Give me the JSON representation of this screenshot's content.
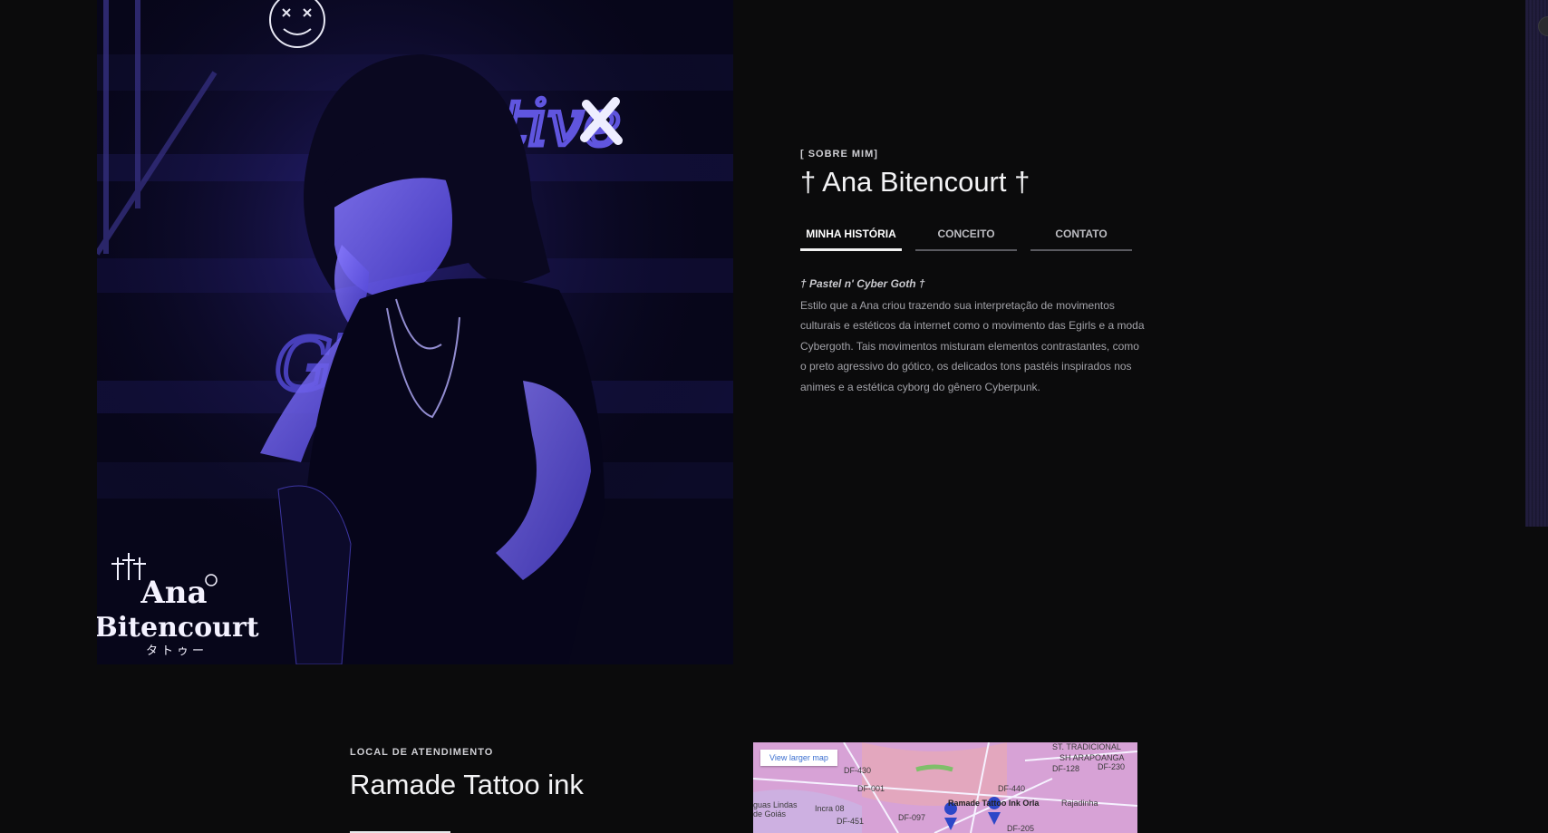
{
  "about": {
    "eyebrow": "[ SOBRE MIM]",
    "title": "† Ana Bitencourt †",
    "tabs": [
      {
        "label": "MINHA HISTÓRIA",
        "active": true
      },
      {
        "label": "CONCEITO",
        "active": false
      },
      {
        "label": "CONTATO",
        "active": false
      }
    ],
    "story_heading": "† Pastel n' Cyber Goth †",
    "story_text": "Estilo que a Ana criou trazendo sua interpretação de movimentos culturais e estéticos da internet como o movimento das Egirls e a moda Cybergoth. Tais movimentos misturam elementos contrastantes, como o preto agressivo do gótico, os delicados tons pastéis inspirados nos animes e a estética cyborg do gênero Cyberpunk."
  },
  "photo": {
    "logo_line1": "Ana",
    "logo_line2": "Bitencourt",
    "logo_sub": "タトゥー",
    "neon_text_top": "Positive",
    "neon_text_bottom": "Gl  ts"
  },
  "location": {
    "eyebrow": "LOCAL DE ATENDIMENTO",
    "title": "Ramade Tattoo ink"
  },
  "map": {
    "link_label": "View larger map",
    "labels": {
      "place": "Ramade Tattoo Ink Orla",
      "city": "guas Lindas de Goiás",
      "area1": "Rajadinha",
      "area2": "ST. TRADICIONAL",
      "area3": "SH ARAPOANGA",
      "area4": "Incra 08",
      "r1": "DF-430",
      "r2": "DF-001",
      "r3": "DF-440",
      "r4": "DF-230",
      "r5": "DF-205",
      "r6": "DF-451",
      "r7": "DF-097",
      "r8": "DF-128"
    }
  },
  "colors": {
    "background": "#0b0b0c",
    "accent_neon": "#5b4dff",
    "text": "#f3f3f5"
  }
}
